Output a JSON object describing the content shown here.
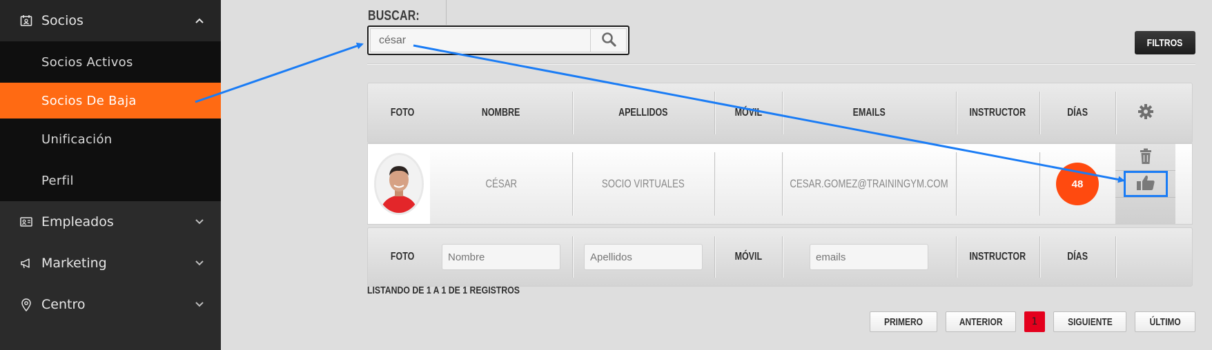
{
  "sidebar": {
    "socios": {
      "label": "Socios",
      "icon": "calendar-user-icon"
    },
    "submenu": [
      {
        "label": "Socios Activos"
      },
      {
        "label": "Socios De Baja",
        "active": true
      },
      {
        "label": "Unificación"
      },
      {
        "label": "Perfil"
      }
    ],
    "sections": [
      {
        "label": "Empleados",
        "icon": "id-card-icon"
      },
      {
        "label": "Marketing",
        "icon": "megaphone-icon"
      },
      {
        "label": "Centro",
        "icon": "location-pin-icon"
      }
    ]
  },
  "search": {
    "label": "BUSCAR:",
    "value": "césar"
  },
  "filters_label": "FILTROS",
  "table": {
    "headers": {
      "foto": "FOTO",
      "nombre": "NOMBRE",
      "apellidos": "APELLIDOS",
      "movil": "MÓVIL",
      "emails": "EMAILS",
      "instructor": "INSTRUCTOR",
      "dias": "DÍAS"
    },
    "rows": [
      {
        "nombre": "CÉSAR",
        "apellidos": "SOCIO VIRTUALES",
        "movil": "",
        "email": "CESAR.GOMEZ@TRAININGYM.COM",
        "instructor": "",
        "dias": "48"
      }
    ],
    "footer": {
      "foto": "FOTO",
      "nombre_placeholder": "Nombre",
      "apellidos_placeholder": "Apellidos",
      "movil": "MÓVIL",
      "emails_placeholder": "emails",
      "instructor": "INSTRUCTOR",
      "dias": "DÍAS"
    }
  },
  "listing": "LISTANDO DE 1 A 1 DE 1 REGISTROS",
  "pagination": {
    "first": "PRIMERO",
    "prev": "ANTERIOR",
    "current": "1",
    "next": "SIGUIENTE",
    "last": "ÚLTIMO"
  },
  "colors": {
    "accent": "#ff6a13",
    "badge": "#ff4a0f",
    "annotation": "#1a7cf5",
    "current_page": "#e4001d"
  }
}
